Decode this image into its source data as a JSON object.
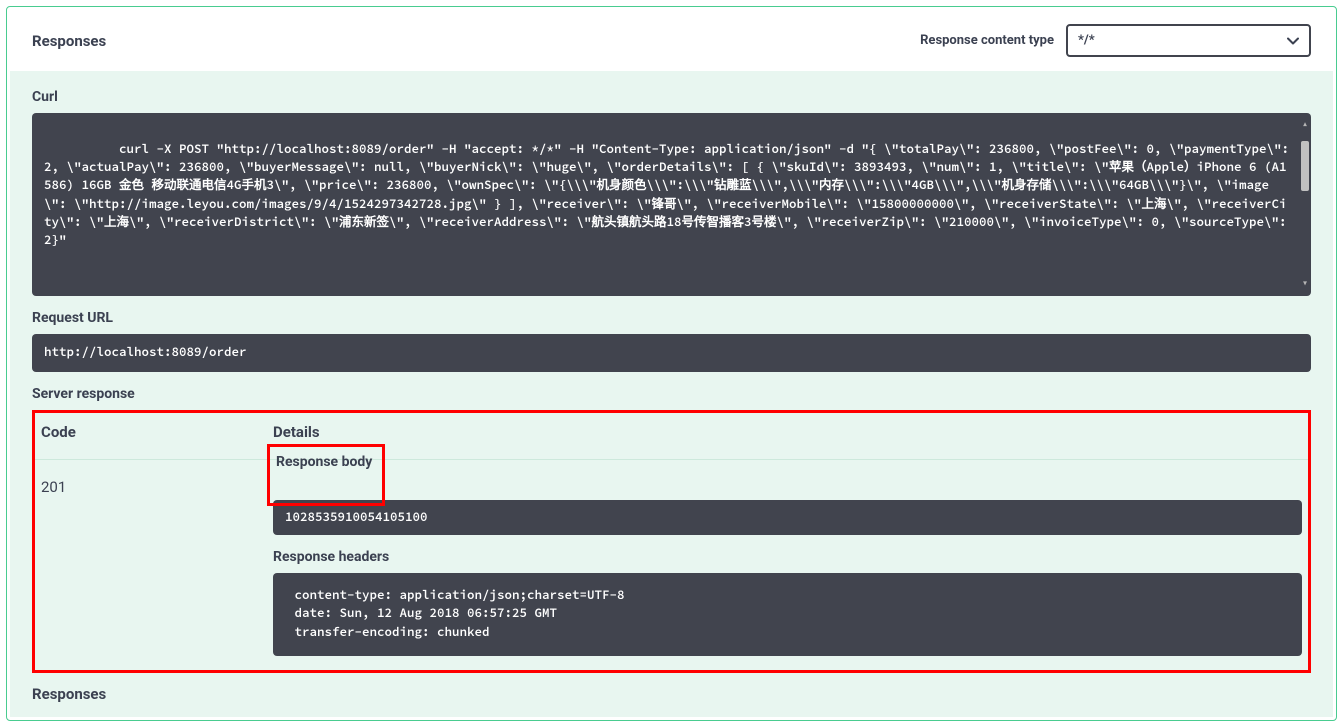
{
  "header": {
    "title": "Responses",
    "content_type_label": "Response content type",
    "content_type_value": "*/*"
  },
  "curl": {
    "label": "Curl",
    "command": "curl -X POST \"http://localhost:8089/order\" -H \"accept: */*\" -H \"Content-Type: application/json\" -d \"{ \\\"totalPay\\\": 236800, \\\"postFee\\\": 0, \\\"paymentType\\\": 2, \\\"actualPay\\\": 236800, \\\"buyerMessage\\\": null, \\\"buyerNick\\\": \\\"huge\\\", \\\"orderDetails\\\": [ { \\\"skuId\\\": 3893493, \\\"num\\\": 1, \\\"title\\\": \\\"苹果（Apple）iPhone 6 (A1586) 16GB 金色 移动联通电信4G手机3\\\", \\\"price\\\": 236800, \\\"ownSpec\\\": \\\"{\\\\\\\"机身颜色\\\\\\\":\\\\\\\"钻雕蓝\\\\\\\",\\\\\\\"内存\\\\\\\":\\\\\\\"4GB\\\\\\\",\\\\\\\"机身存储\\\\\\\":\\\\\\\"64GB\\\\\\\"}\\\", \\\"image\\\": \\\"http://image.leyou.com/images/9/4/1524297342728.jpg\\\" } ], \\\"receiver\\\": \\\"锋哥\\\", \\\"receiverMobile\\\": \\\"15800000000\\\", \\\"receiverState\\\": \\\"上海\\\", \\\"receiverCity\\\": \\\"上海\\\", \\\"receiverDistrict\\\": \\\"浦东新签\\\", \\\"receiverAddress\\\": \\\"航头镇航头路18号传智播客3号楼\\\", \\\"receiverZip\\\": \\\"210000\\\", \\\"invoiceType\\\": 0, \\\"sourceType\\\":2}\""
  },
  "request_url": {
    "label": "Request URL",
    "value": "http://localhost:8089/order"
  },
  "server_response": {
    "label": "Server response",
    "code_header": "Code",
    "details_header": "Details",
    "status_code": "201",
    "body_label": "Response body",
    "body_value": "1028535910054105100",
    "headers_label": "Response headers",
    "headers_value": " content-type: application/json;charset=UTF-8 \n date: Sun, 12 Aug 2018 06:57:25 GMT \n transfer-encoding: chunked "
  },
  "footer": {
    "responses_label": "Responses"
  }
}
